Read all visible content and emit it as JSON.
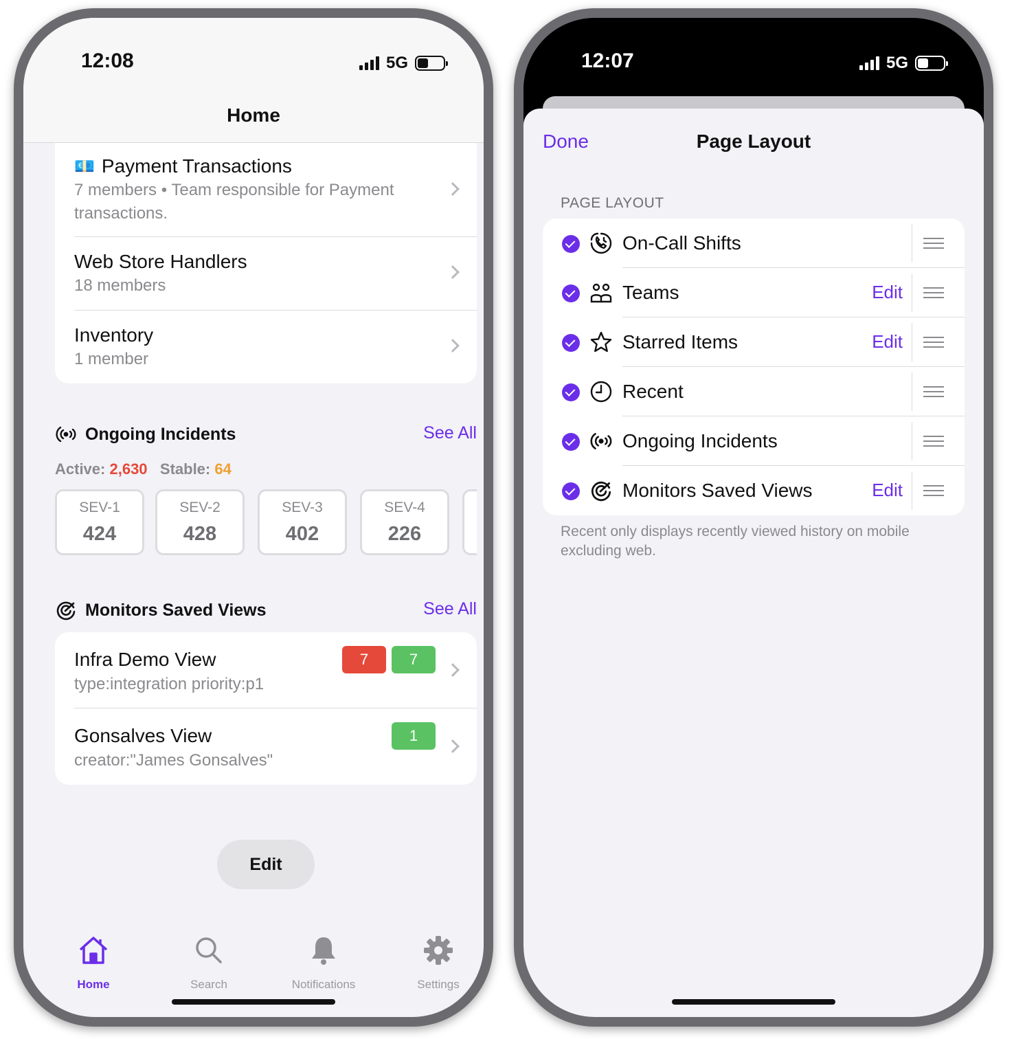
{
  "left_phone": {
    "status": {
      "time": "12:08",
      "network": "5G"
    },
    "nav_title": "Home",
    "teams": [
      {
        "emoji": "💶",
        "name": "Payment Transactions",
        "sub": "7 members • Team responsible for Payment transactions."
      },
      {
        "name": "Web Store Handlers",
        "sub": "18 members"
      },
      {
        "name": "Inventory",
        "sub": "1 member"
      }
    ],
    "incidents": {
      "title": "Ongoing Incidents",
      "see_all": "See All",
      "active_label": "Active:",
      "active_value": "2,630",
      "stable_label": "Stable:",
      "stable_value": "64",
      "severities": [
        {
          "label": "SEV-1",
          "value": "424"
        },
        {
          "label": "SEV-2",
          "value": "428"
        },
        {
          "label": "SEV-3",
          "value": "402"
        },
        {
          "label": "SEV-4",
          "value": "226"
        }
      ]
    },
    "monitors": {
      "title": "Monitors Saved Views",
      "see_all": "See All",
      "views": [
        {
          "name": "Infra Demo View",
          "query": "type:integration priority:p1",
          "badges": [
            {
              "value": "7",
              "color": "#e5493a"
            },
            {
              "value": "7",
              "color": "#5ac262"
            }
          ]
        },
        {
          "name": "Gonsalves View",
          "query": "creator:\"James Gonsalves\"",
          "badges": [
            {
              "value": "1",
              "color": "#5ac262"
            }
          ]
        }
      ]
    },
    "edit_button": "Edit",
    "tabs": [
      {
        "label": "Home",
        "icon": "home-icon",
        "active": true
      },
      {
        "label": "Search",
        "icon": "search-icon",
        "active": false
      },
      {
        "label": "Notifications",
        "icon": "bell-icon",
        "active": false
      },
      {
        "label": "Settings",
        "icon": "gear-icon",
        "active": false
      }
    ]
  },
  "right_phone": {
    "status": {
      "time": "12:07",
      "network": "5G"
    },
    "done": "Done",
    "title": "Page Layout",
    "group_label": "PAGE LAYOUT",
    "items": [
      {
        "name": "On-Call Shifts",
        "icon": "on-call-icon",
        "checked": true,
        "edit": ""
      },
      {
        "name": "Teams",
        "icon": "teams-icon",
        "checked": true,
        "edit": "Edit"
      },
      {
        "name": "Starred Items",
        "icon": "star-icon",
        "checked": true,
        "edit": "Edit"
      },
      {
        "name": "Recent",
        "icon": "clock-icon",
        "checked": true,
        "edit": ""
      },
      {
        "name": "Ongoing Incidents",
        "icon": "incidents-icon",
        "checked": true,
        "edit": ""
      },
      {
        "name": "Monitors Saved Views",
        "icon": "monitor-icon",
        "checked": true,
        "edit": "Edit"
      }
    ],
    "footer": "Recent only displays recently viewed history on mobile excluding web."
  },
  "colors": {
    "accent": "#6b2ee8",
    "active_red": "#e5493a",
    "stable_orange": "#f0a030",
    "badge_green": "#5ac262"
  }
}
